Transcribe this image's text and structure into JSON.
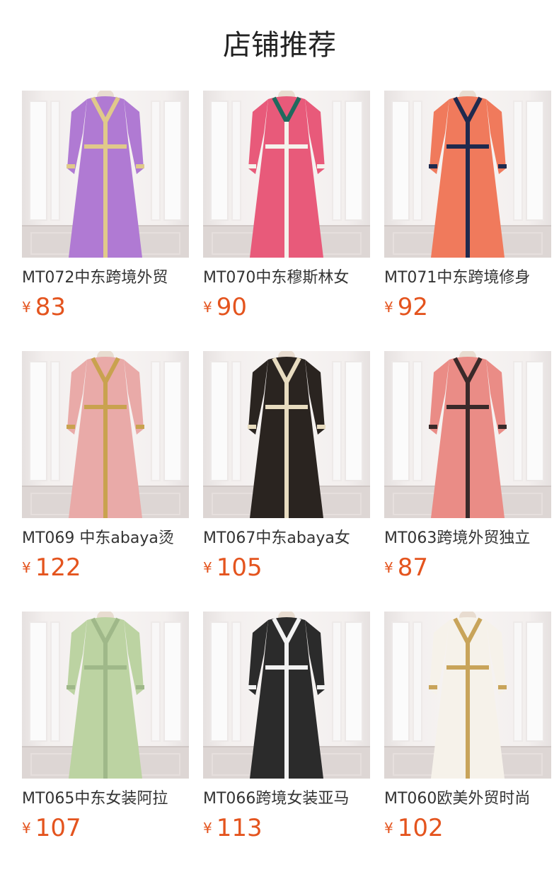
{
  "section_title": "店铺推荐",
  "products": [
    {
      "name": "MT072中东跨境外贸",
      "currency": "¥",
      "price": "83",
      "dress_color": "#b07ad3",
      "accent_color": "#e0c98a",
      "neck_color": "#e0c98a"
    },
    {
      "name": "MT070中东穆斯林女",
      "currency": "¥",
      "price": "90",
      "dress_color": "#e85a7a",
      "accent_color": "#f4f2ec",
      "neck_color": "#1f6a5e"
    },
    {
      "name": "MT071中东跨境修身",
      "currency": "¥",
      "price": "92",
      "dress_color": "#f07a5c",
      "accent_color": "#1f2a4e",
      "neck_color": "#1f2a4e"
    },
    {
      "name": "MT069 中东abaya烫",
      "currency": "¥",
      "price": "122",
      "dress_color": "#e9aaa8",
      "accent_color": "#c9a24f",
      "neck_color": "#c9a24f"
    },
    {
      "name": "MT067中东abaya女",
      "currency": "¥",
      "price": "105",
      "dress_color": "#2a2420",
      "accent_color": "#e8dcc0",
      "neck_color": "#e8dcc0"
    },
    {
      "name": "MT063跨境外贸独立",
      "currency": "¥",
      "price": "87",
      "dress_color": "#ea8c86",
      "accent_color": "#3a2a2a",
      "neck_color": "#3a2a2a"
    },
    {
      "name": "MT065中东女装阿拉",
      "currency": "¥",
      "price": "107",
      "dress_color": "#bcd3a2",
      "accent_color": "#9fb889",
      "neck_color": "#9fb889"
    },
    {
      "name": "MT066跨境女装亚马",
      "currency": "¥",
      "price": "113",
      "dress_color": "#2b2b2b",
      "accent_color": "#f2f2f2",
      "neck_color": "#f2f2f2"
    },
    {
      "name": "MT060欧美外贸时尚",
      "currency": "¥",
      "price": "102",
      "dress_color": "#f6f2ea",
      "accent_color": "#c8a45a",
      "neck_color": "#c8a45a"
    }
  ]
}
